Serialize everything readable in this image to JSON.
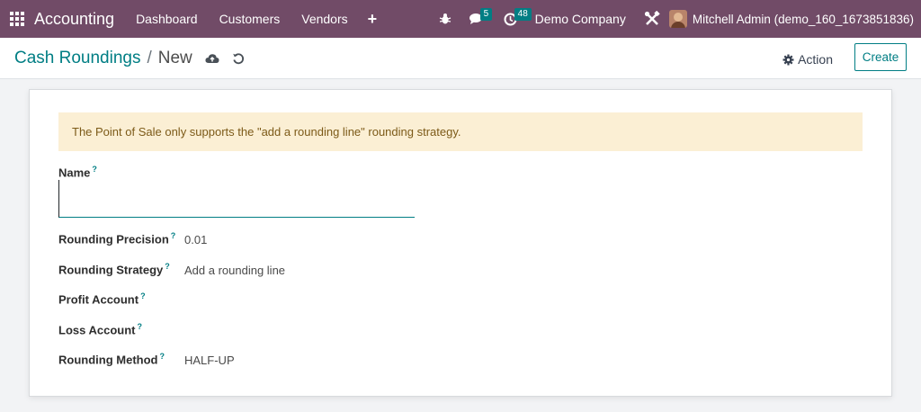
{
  "navbar": {
    "app_name": "Accounting",
    "menu": [
      "Dashboard",
      "Customers",
      "Vendors"
    ],
    "plus_label": "+",
    "messages_count": "5",
    "activities_count": "48",
    "company": "Demo Company",
    "user": "Mitchell Admin (demo_160_1673851836)"
  },
  "breadcrumb": {
    "parent": "Cash Roundings",
    "separator": "/",
    "current": "New"
  },
  "control": {
    "action_label": "Action",
    "create_label": "Create"
  },
  "form": {
    "alert": "The Point of Sale only supports the \"add a rounding line\" rounding strategy.",
    "help_mark": "?",
    "name_label": "Name",
    "name_value": "",
    "rounding_precision_label": "Rounding Precision",
    "rounding_precision_value": "0.01",
    "rounding_strategy_label": "Rounding Strategy",
    "rounding_strategy_value": "Add a rounding line",
    "profit_account_label": "Profit Account",
    "profit_account_value": "",
    "loss_account_label": "Loss Account",
    "loss_account_value": "",
    "rounding_method_label": "Rounding Method",
    "rounding_method_value": "HALF-UP"
  },
  "colors": {
    "navbar": "#714b67",
    "accent": "#017e84",
    "alert_bg": "#fbefd4"
  }
}
